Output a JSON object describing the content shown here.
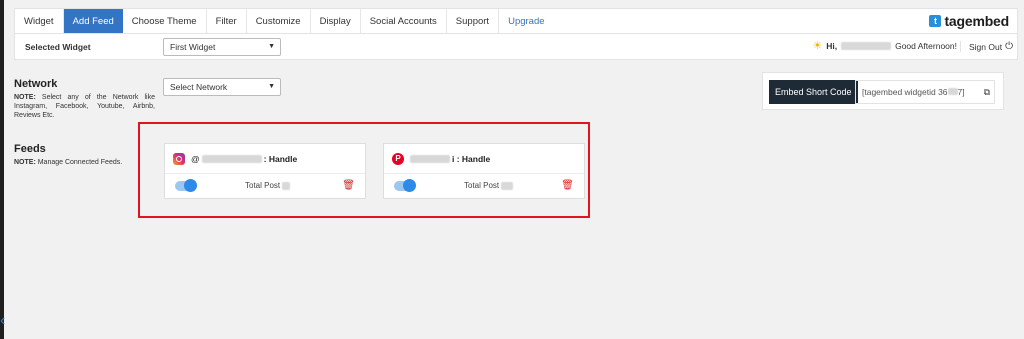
{
  "nav": {
    "tabs": [
      {
        "label": "Widget"
      },
      {
        "label": "Add Feed"
      },
      {
        "label": "Choose Theme"
      },
      {
        "label": "Filter"
      },
      {
        "label": "Customize"
      },
      {
        "label": "Display"
      },
      {
        "label": "Social Accounts"
      },
      {
        "label": "Support"
      },
      {
        "label": "Upgrade"
      }
    ],
    "active_tab": "Add Feed",
    "brand": "tagembed"
  },
  "subbar": {
    "selected_widget_label": "Selected Widget",
    "widget_select_value": "First Widget",
    "greeting_prefix": "Hi,",
    "greeting_suffix": "Good Afternoon!",
    "sign_out": "Sign Out"
  },
  "network": {
    "title": "Network",
    "note_prefix": "NOTE:",
    "note_text": " Select any of the Network like Instagram, Facebook, Youtube, Airbnb, Reviews Etc.",
    "select_value": "Select Network"
  },
  "embed": {
    "button_label": "Embed Short Code",
    "code_text": "[tagembed widgetid 36",
    "code_end": "7]"
  },
  "feeds": {
    "title": "Feeds",
    "note_prefix": "NOTE:",
    "note_text": " Manage Connected Feeds.",
    "items": [
      {
        "network": "instagram",
        "prefix": "@",
        "handle_suffix": ": Handle",
        "total_label": "Total Post",
        "enabled": true
      },
      {
        "network": "pinterest",
        "prefix": "",
        "handle_suffix": "i : Handle",
        "total_label": "Total Post",
        "enabled": true
      }
    ]
  },
  "colors": {
    "accent": "#3374c4",
    "highlight": "#e0141e",
    "toggle": "#2d8ae8",
    "delete": "#d42a2a"
  },
  "icons": [
    "instagram-icon",
    "pinterest-icon",
    "trash-icon",
    "copy-icon",
    "power-icon",
    "sun-icon",
    "caret-down-icon",
    "tagembed-logo-icon"
  ]
}
